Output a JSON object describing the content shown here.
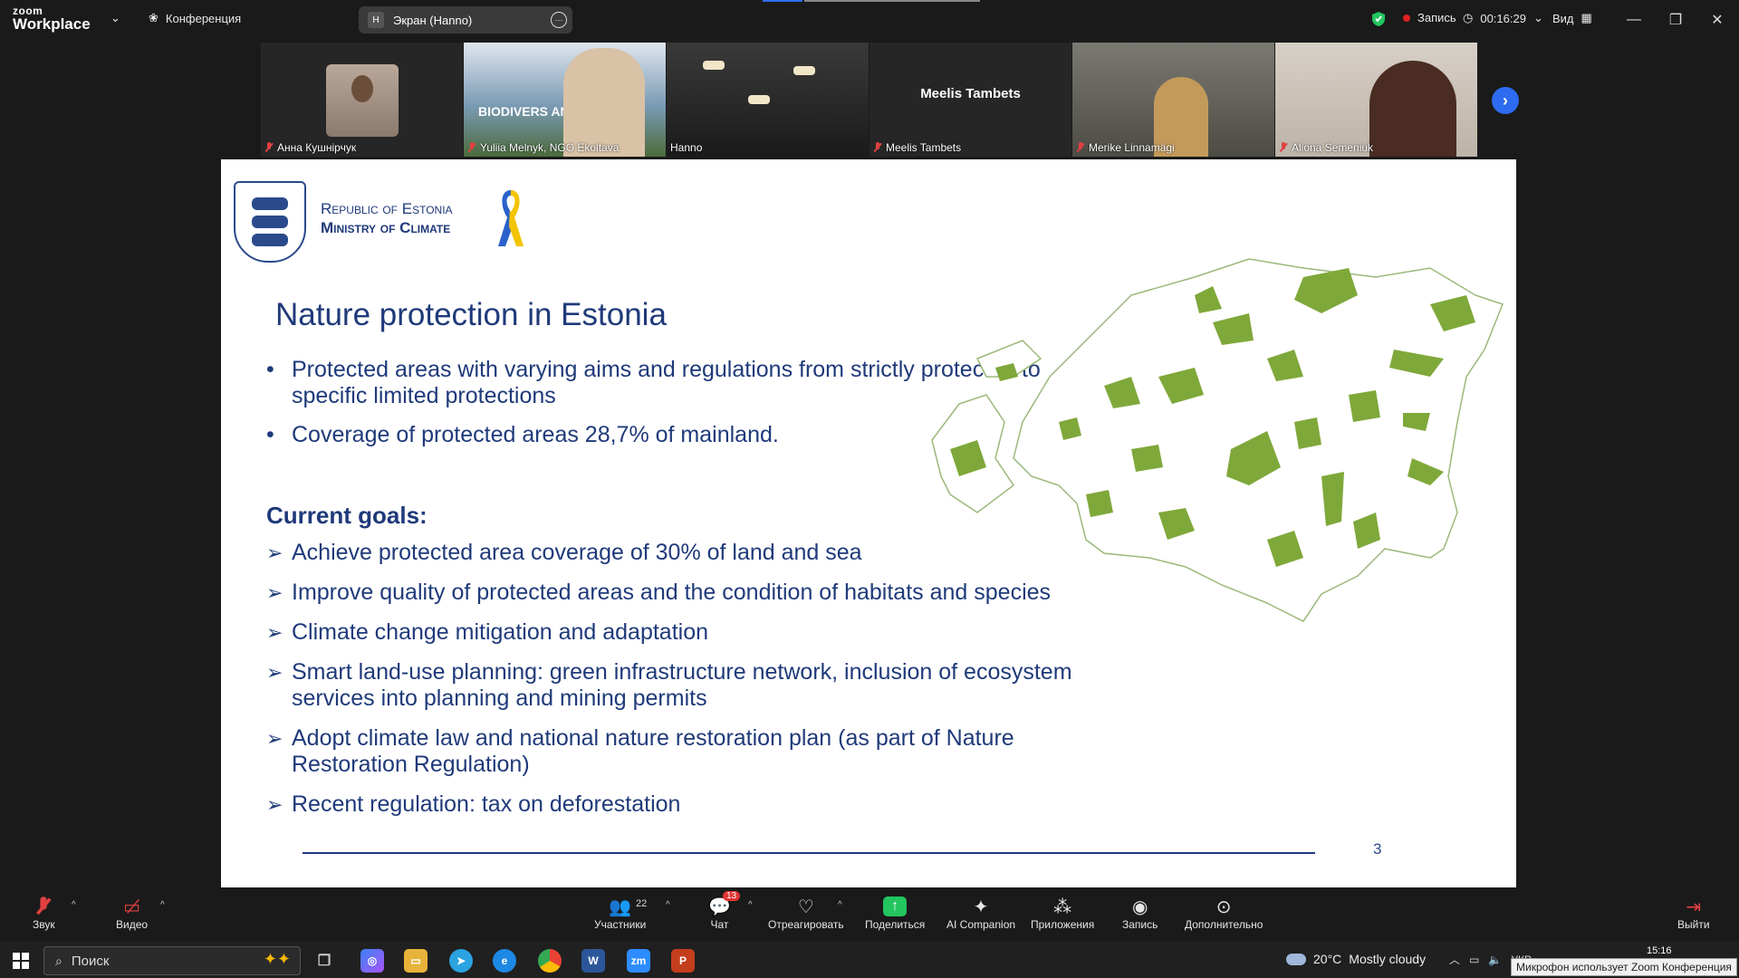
{
  "app": {
    "logo_line1": "zoom",
    "logo_line2": "Workplace",
    "meeting_label": "Конференция",
    "share_badge": "H",
    "share_label": "Экран (Hanno)",
    "security_color": "#22c55e",
    "recording_label": "Запись",
    "timer": "00:16:29",
    "view_label": "Вид"
  },
  "participants": [
    {
      "name": "Анна Кушнірчук",
      "muted": true,
      "kind": "avatar"
    },
    {
      "name": "Yuliia Melnyk, NGO Ekoltava",
      "muted": true,
      "kind": "video",
      "overlay_text": "BIODIVERS AND EU"
    },
    {
      "name": "Hanno",
      "muted": false,
      "kind": "video",
      "active_speaker": true
    },
    {
      "name": "Meelis Tambets",
      "muted": true,
      "kind": "name-only",
      "display_name": "Meelis Tambets"
    },
    {
      "name": "Merike Linnamägi",
      "muted": true,
      "kind": "video"
    },
    {
      "name": "Aliona Semeniuk",
      "muted": true,
      "kind": "video"
    }
  ],
  "slide": {
    "org_line1": "Republic of Estonia",
    "org_line2": "Ministry of Climate",
    "title": "Nature protection in Estonia",
    "bullets": [
      "Protected areas with varying aims and regulations from strictly protected to specific limited protections",
      "Coverage of protected areas 28,7% of mainland."
    ],
    "goals_heading": "Current goals:",
    "goals": [
      "Achieve protected area coverage of 30% of land and sea",
      "Improve quality of protected areas and the condition of habitats and species",
      "Climate change mitigation and adaptation",
      "Smart land-use planning: green infrastructure network, inclusion of ecosystem services into planning and mining permits",
      " Adopt climate law and national nature restoration plan (as part of Nature Restoration Regulation)",
      "Recent regulation: tax on deforestation"
    ],
    "page_number": "3",
    "accent_color": "#1f3a7a",
    "map_color": "#7fa83a"
  },
  "toolbar": {
    "audio": "Звук",
    "video": "Видео",
    "participants": "Участники",
    "participants_count": "22",
    "chat": "Чат",
    "chat_badge": "13",
    "react": "Отреагировать",
    "share": "Поделиться",
    "companion": "AI Companion",
    "apps": "Приложения",
    "record": "Запись",
    "more": "Дополнительно",
    "leave": "Выйти"
  },
  "taskbar": {
    "search_placeholder": "Поиск",
    "weather_temp": "20°C",
    "weather_text": "Mostly cloudy",
    "lang": "УКР",
    "time": "15:16",
    "tooltip": "Микрофон использует Zoom Конференция"
  }
}
